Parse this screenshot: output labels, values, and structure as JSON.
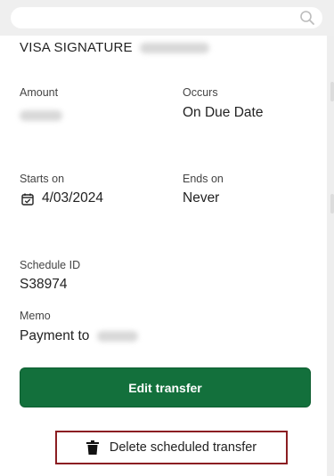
{
  "search": {
    "placeholder": ""
  },
  "account": {
    "name": "VISA SIGNATURE"
  },
  "details": {
    "amount_label": "Amount",
    "occurs_label": "Occurs",
    "occurs_value": "On Due Date",
    "starts_label": "Starts on",
    "starts_value": "4/03/2024",
    "ends_label": "Ends on",
    "ends_value": "Never",
    "schedule_id_label": "Schedule ID",
    "schedule_id_value": "S38974",
    "memo_label": "Memo",
    "memo_value": "Payment to"
  },
  "actions": {
    "edit_label": "Edit transfer",
    "delete_label": "Delete scheduled transfer"
  },
  "colors": {
    "primary_button": "#13703c",
    "delete_border": "#8b1e22"
  },
  "icons": [
    "search-icon",
    "calendar-icon",
    "trash-icon"
  ]
}
